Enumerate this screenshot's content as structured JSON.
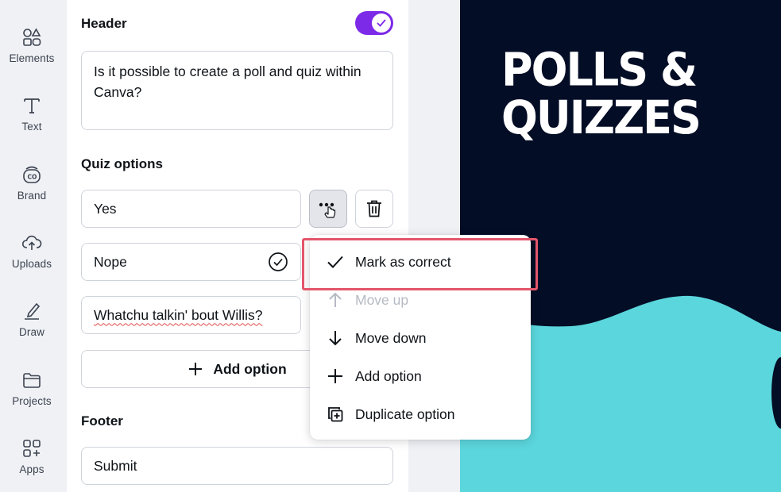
{
  "sidebar": {
    "items": [
      {
        "label": "Elements",
        "icon": "elements-icon"
      },
      {
        "label": "Text",
        "icon": "text-icon"
      },
      {
        "label": "Brand",
        "icon": "brand-icon"
      },
      {
        "label": "Uploads",
        "icon": "uploads-icon"
      },
      {
        "label": "Draw",
        "icon": "draw-icon"
      },
      {
        "label": "Projects",
        "icon": "projects-icon"
      },
      {
        "label": "Apps",
        "icon": "apps-icon"
      }
    ]
  },
  "panel": {
    "header_title": "Header",
    "header_toggle_on": true,
    "header_text": "Is it possible to create a poll and quiz within Canva?",
    "quiz_title": "Quiz options",
    "options": [
      {
        "text": "Yes",
        "correct": false
      },
      {
        "text": "Nope",
        "correct": true
      },
      {
        "text": "Whatchu talkin' bout Willis?",
        "correct": false
      }
    ],
    "add_option_label": "Add option",
    "footer_title": "Footer",
    "footer_text": "Submit"
  },
  "menu": {
    "items": [
      {
        "label": "Mark as correct",
        "icon": "check-icon",
        "disabled": false
      },
      {
        "label": "Move up",
        "icon": "arrow-up-icon",
        "disabled": true
      },
      {
        "label": "Move down",
        "icon": "arrow-down-icon",
        "disabled": false
      },
      {
        "label": "Add option",
        "icon": "plus-icon",
        "disabled": false
      },
      {
        "label": "Duplicate option",
        "icon": "duplicate-icon",
        "disabled": false
      }
    ]
  },
  "canvas": {
    "title_line1": "POLLS &",
    "title_line2": "QUIZZES"
  },
  "colors": {
    "accent": "#7d2ae8",
    "canvas_dark": "#030d25",
    "canvas_teal": "#5bd6dc",
    "highlight": "#e3566b"
  }
}
